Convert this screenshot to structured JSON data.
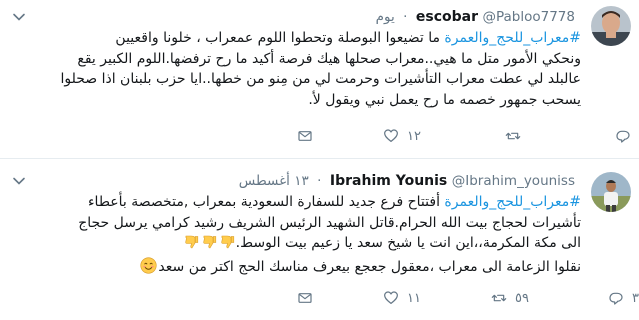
{
  "tweets": [
    {
      "display_name": "escobar",
      "username": "@Pabloo7778",
      "separator": "·",
      "time": "يوم",
      "hashtag": "#معراب_للحج_والعمرة",
      "text_after_hashtag": " ما تضيعوا البوصلة وتحطوا اللوم عمعراب ، خلونا واقعيين",
      "lines": [
        "ونحكي الأمور متل ما هيي..معراب صحلها هيك فرصة أكيد ما رح ترفضها.اللوم الكبير يقع",
        "عالبلد لي عطت معراب التأشيرات وحرمت لي من مِنو من خطها..ايا حزب بلبنان اذا صحلوا",
        "يسحب جمهور خصمه ما رح يعمل نبي ويقول لأ."
      ],
      "reply_count": "",
      "retweet_count": "",
      "like_count": "١٢",
      "icons": {
        "avatar": "profile-photo-man",
        "menu": "chevron-down-icon",
        "reply": "reply-icon",
        "retweet": "retweet-icon",
        "like": "heart-icon",
        "dm": "envelope-icon"
      }
    },
    {
      "display_name": "Ibrahim Younis",
      "username": "@Ibrahim_youniss",
      "separator": "·",
      "time": "١٣ أغسطس",
      "hashtag": "#معراب_للحج_والعمرة",
      "text_after_hashtag": " أفتتاح فرع جديد للسفارة السعودية بمعراب ,متخصصة بأعطاء",
      "lines": [
        "تأشيرات لحجاج بيت الله الحرام.قاتل الشهيد الرئيس الشريف رشيد كرامي يرسل حجاج",
        "الى مكة المكرمة،،اين انت يا شيخ سعد يا زعيم بيت الوسط.",
        "نقلوا الزعامة الى معراب ،معقول جعجع بيعرف مناسك الحج اكتر من سعد"
      ],
      "reply_count": "٣",
      "retweet_count": "٥٩",
      "like_count": "١١",
      "icons": {
        "avatar": "profile-photo-man-outdoors",
        "menu": "chevron-down-icon",
        "thumbs_down": "thumbs-down-emoji",
        "smile": "smiling-face-emoji",
        "reply": "reply-icon",
        "retweet": "retweet-icon",
        "like": "heart-icon",
        "dm": "envelope-icon"
      }
    }
  ],
  "colors": {
    "hashtag": "#1b95e0",
    "text": "#14171a",
    "muted": "#657786",
    "separator": "#e6ecf0",
    "emoji_yellow": "#ffcc4d"
  }
}
